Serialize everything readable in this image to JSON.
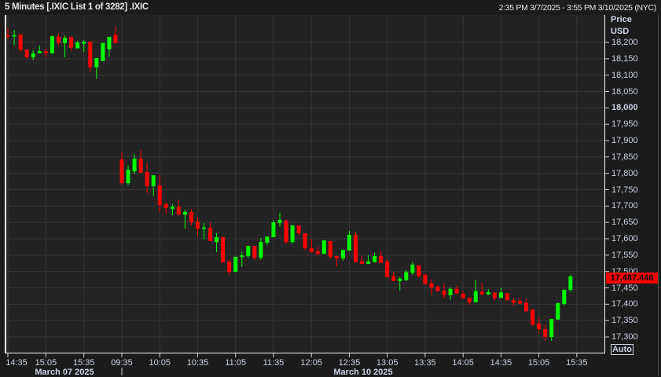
{
  "header": {
    "title": "5 Minutes [.IXIC List 1 of 3282] .IXIC",
    "range": "2:35 PM 3/7/2025 - 3:55 PM 3/10/2025 (NYC)"
  },
  "axis": {
    "price_label": "Price",
    "currency_label": "USD",
    "auto_label": "Auto",
    "last_price": "17,487.446",
    "last_price_value": 17487.446,
    "price_ticks": [
      {
        "value": 18200,
        "label": "18,200"
      },
      {
        "value": 18150,
        "label": "18,150"
      },
      {
        "value": 18100,
        "label": "18,100"
      },
      {
        "value": 18050,
        "label": "18,050"
      },
      {
        "value": 18000,
        "label": "18,000",
        "bold": true
      },
      {
        "value": 17950,
        "label": "17,950"
      },
      {
        "value": 17900,
        "label": "17,900"
      },
      {
        "value": 17850,
        "label": "17,850"
      },
      {
        "value": 17800,
        "label": "17,800"
      },
      {
        "value": 17750,
        "label": "17,750"
      },
      {
        "value": 17700,
        "label": "17,700"
      },
      {
        "value": 17650,
        "label": "17,650"
      },
      {
        "value": 17600,
        "label": "17,600"
      },
      {
        "value": 17550,
        "label": "17,550"
      },
      {
        "value": 17500,
        "label": "17,500"
      },
      {
        "value": 17450,
        "label": "17,450"
      },
      {
        "value": 17400,
        "label": "17,400"
      },
      {
        "value": 17350,
        "label": "17,350"
      },
      {
        "value": 17300,
        "label": "17,300"
      }
    ],
    "time_ticks": [
      {
        "day": 0,
        "label": "14:35"
      },
      {
        "day": 0,
        "label": "15:05"
      },
      {
        "day": 0,
        "label": "15:35"
      },
      {
        "day": 1,
        "label": "09:35"
      },
      {
        "day": 1,
        "label": "10:05"
      },
      {
        "day": 1,
        "label": "10:35"
      },
      {
        "day": 1,
        "label": "11:05"
      },
      {
        "day": 1,
        "label": "11:35"
      },
      {
        "day": 1,
        "label": "12:05"
      },
      {
        "day": 1,
        "label": "12:35"
      },
      {
        "day": 1,
        "label": "13:05"
      },
      {
        "day": 1,
        "label": "13:35"
      },
      {
        "day": 1,
        "label": "14:05"
      },
      {
        "day": 1,
        "label": "14:35"
      },
      {
        "day": 1,
        "label": "15:05"
      },
      {
        "day": 1,
        "label": "15:35"
      }
    ],
    "dates": [
      "March 07 2025",
      "March 10 2025"
    ]
  },
  "colors": {
    "up": "#00ff00",
    "down": "#ff0000",
    "grid": "#363636",
    "tag": "#ff0000"
  },
  "chart_data": {
    "type": "candlestick",
    "interval": "5 Minutes",
    "symbol": ".IXIC",
    "ylim": [
      17270,
      18260
    ],
    "days": [
      {
        "date": "March 07 2025",
        "start": "14:35",
        "ohlc": [
          [
            18222,
            18244,
            18210,
            18220
          ],
          [
            18220,
            18238,
            18192,
            18222
          ],
          [
            18224,
            18226,
            18170,
            18178
          ],
          [
            18178,
            18180,
            18148,
            18155
          ],
          [
            18155,
            18176,
            18146,
            18166
          ],
          [
            18167,
            18190,
            18167,
            18173
          ],
          [
            18173,
            18182,
            18154,
            18167
          ],
          [
            18167,
            18221,
            18165,
            18219
          ],
          [
            18218,
            18228,
            18192,
            18198
          ],
          [
            18198,
            18222,
            18155,
            18214
          ],
          [
            18217,
            18218,
            18174,
            18184
          ],
          [
            18182,
            18205,
            18182,
            18200
          ],
          [
            18196,
            18207,
            18172,
            18202
          ],
          [
            18202,
            18203,
            18112,
            18124
          ],
          [
            18124,
            18152,
            18088,
            18152
          ],
          [
            18143,
            18198,
            18143,
            18198
          ],
          [
            18179,
            18217,
            18155,
            18217
          ],
          [
            18224,
            18250,
            18198,
            18198
          ]
        ]
      },
      {
        "date": "March 10 2025",
        "start": "09:35",
        "ohlc": [
          [
            17842,
            17866,
            17766,
            17770
          ],
          [
            17770,
            17825,
            17764,
            17811
          ],
          [
            17806,
            17859,
            17799,
            17845
          ],
          [
            17845,
            17871,
            17800,
            17802
          ],
          [
            17804,
            17833,
            17739,
            17761
          ],
          [
            17761,
            17794,
            17730,
            17794
          ],
          [
            17763,
            17797,
            17682,
            17703
          ],
          [
            17706,
            17713,
            17677,
            17694
          ],
          [
            17691,
            17706,
            17672,
            17698
          ],
          [
            17698,
            17718,
            17670,
            17674
          ],
          [
            17674,
            17689,
            17631,
            17682
          ],
          [
            17682,
            17691,
            17641,
            17650
          ],
          [
            17653,
            17667,
            17607,
            17631
          ],
          [
            17631,
            17648,
            17598,
            17634
          ],
          [
            17634,
            17650,
            17593,
            17593
          ],
          [
            17590,
            17617,
            17559,
            17605
          ],
          [
            17605,
            17605,
            17526,
            17528
          ],
          [
            17530,
            17538,
            17490,
            17499
          ],
          [
            17499,
            17545,
            17499,
            17545
          ],
          [
            17544,
            17561,
            17514,
            17549
          ],
          [
            17547,
            17578,
            17540,
            17578
          ],
          [
            17578,
            17578,
            17535,
            17542
          ],
          [
            17542,
            17602,
            17535,
            17590
          ],
          [
            17588,
            17607,
            17581,
            17607
          ],
          [
            17605,
            17658,
            17605,
            17650
          ],
          [
            17648,
            17679,
            17636,
            17658
          ],
          [
            17655,
            17660,
            17583,
            17590
          ],
          [
            17590,
            17641,
            17586,
            17641
          ],
          [
            17641,
            17641,
            17607,
            17617
          ],
          [
            17617,
            17617,
            17564,
            17571
          ],
          [
            17571,
            17600,
            17559,
            17559
          ],
          [
            17562,
            17576,
            17547,
            17554
          ],
          [
            17554,
            17595,
            17554,
            17595
          ],
          [
            17593,
            17593,
            17538,
            17545
          ],
          [
            17547,
            17547,
            17516,
            17540
          ],
          [
            17540,
            17566,
            17533,
            17566
          ],
          [
            17564,
            17624,
            17564,
            17612
          ],
          [
            17612,
            17622,
            17528,
            17528
          ],
          [
            17531,
            17548,
            17523,
            17523
          ],
          [
            17523,
            17550,
            17523,
            17531
          ],
          [
            17529,
            17558,
            17527,
            17547
          ],
          [
            17547,
            17562,
            17526,
            17526
          ],
          [
            17531,
            17538,
            17483,
            17483
          ],
          [
            17486,
            17499,
            17471,
            17471
          ],
          [
            17471,
            17483,
            17442,
            17478
          ],
          [
            17474,
            17504,
            17471,
            17498
          ],
          [
            17496,
            17529,
            17490,
            17521
          ],
          [
            17519,
            17519,
            17481,
            17486
          ],
          [
            17490,
            17493,
            17462,
            17462
          ],
          [
            17464,
            17474,
            17428,
            17451
          ],
          [
            17454,
            17458,
            17440,
            17440
          ],
          [
            17442,
            17464,
            17418,
            17428
          ],
          [
            17428,
            17452,
            17414,
            17447
          ],
          [
            17447,
            17458,
            17430,
            17433
          ],
          [
            17432,
            17440,
            17418,
            17418
          ],
          [
            17420,
            17420,
            17398,
            17406
          ],
          [
            17406,
            17474,
            17406,
            17440
          ],
          [
            17439,
            17466,
            17428,
            17430
          ],
          [
            17430,
            17446,
            17428,
            17437
          ],
          [
            17436,
            17436,
            17410,
            17419
          ],
          [
            17419,
            17450,
            17419,
            17436
          ],
          [
            17434,
            17434,
            17412,
            17412
          ],
          [
            17412,
            17419,
            17396,
            17405
          ],
          [
            17410,
            17417,
            17402,
            17402
          ],
          [
            17405,
            17417,
            17378,
            17378
          ],
          [
            17384,
            17384,
            17334,
            17338
          ],
          [
            17341,
            17360,
            17310,
            17324
          ],
          [
            17324,
            17338,
            17288,
            17300
          ],
          [
            17300,
            17355,
            17288,
            17355
          ],
          [
            17353,
            17405,
            17353,
            17403
          ],
          [
            17401,
            17446,
            17396,
            17444
          ],
          [
            17444,
            17490,
            17437,
            17485
          ]
        ]
      }
    ]
  }
}
